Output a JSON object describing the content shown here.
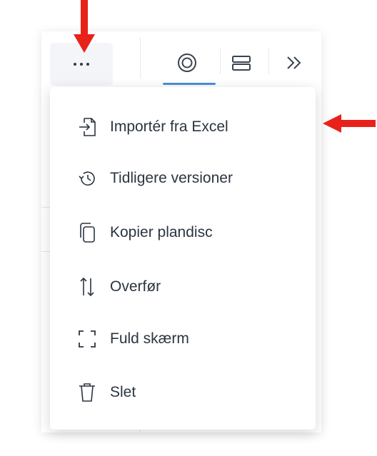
{
  "toolbar": {
    "more_icon": "more-horizontal-icon",
    "icons": [
      "target-icon",
      "rows-icon",
      "chevrons-right-icon"
    ]
  },
  "menu": {
    "items": [
      {
        "label": "Importér fra Excel",
        "icon": "import-icon"
      },
      {
        "label": "Tidligere versioner",
        "icon": "history-icon"
      },
      {
        "label": "Kopier plandisc",
        "icon": "copy-icon"
      },
      {
        "label": "Overfør",
        "icon": "transfer-icon"
      },
      {
        "label": "Fuld skærm",
        "icon": "fullscreen-icon"
      },
      {
        "label": "Slet",
        "icon": "trash-icon"
      }
    ]
  },
  "annotations": {
    "color": "#e8221b"
  }
}
